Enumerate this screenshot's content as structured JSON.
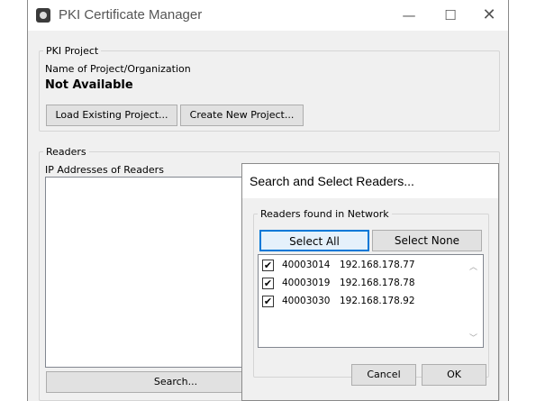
{
  "window": {
    "title": "PKI Certificate Manager",
    "minimize_icon": "minimize-icon",
    "maximize_icon": "maximize-icon",
    "close_icon": "close-icon",
    "minimize_glyph": "—",
    "maximize_glyph": "☐",
    "close_glyph": "✕"
  },
  "pki_project": {
    "legend": "PKI Project",
    "name_label": "Name of Project/Organization",
    "name_value": "Not Available",
    "load_button": "Load Existing Project...",
    "create_button": "Create New Project..."
  },
  "readers": {
    "legend": "Readers",
    "ip_label": "IP Addresses of Readers",
    "search_button": "Search..."
  },
  "dialog": {
    "title": "Search and Select Readers...",
    "group_legend": "Readers found in Network",
    "select_all": "Select All",
    "select_none": "Select None",
    "check_glyph": "✔",
    "items": [
      {
        "id": "40003014",
        "ip": "192.168.178.77",
        "checked": true
      },
      {
        "id": "40003019",
        "ip": "192.168.178.78",
        "checked": true
      },
      {
        "id": "40003030",
        "ip": "192.168.178.92",
        "checked": true
      }
    ],
    "scroll_up_glyph": "︿",
    "scroll_down_glyph": "﹀",
    "cancel_button": "Cancel",
    "ok_button": "OK"
  },
  "colors": {
    "focus_border": "#0078d7",
    "window_bg": "#f0f0f0"
  }
}
